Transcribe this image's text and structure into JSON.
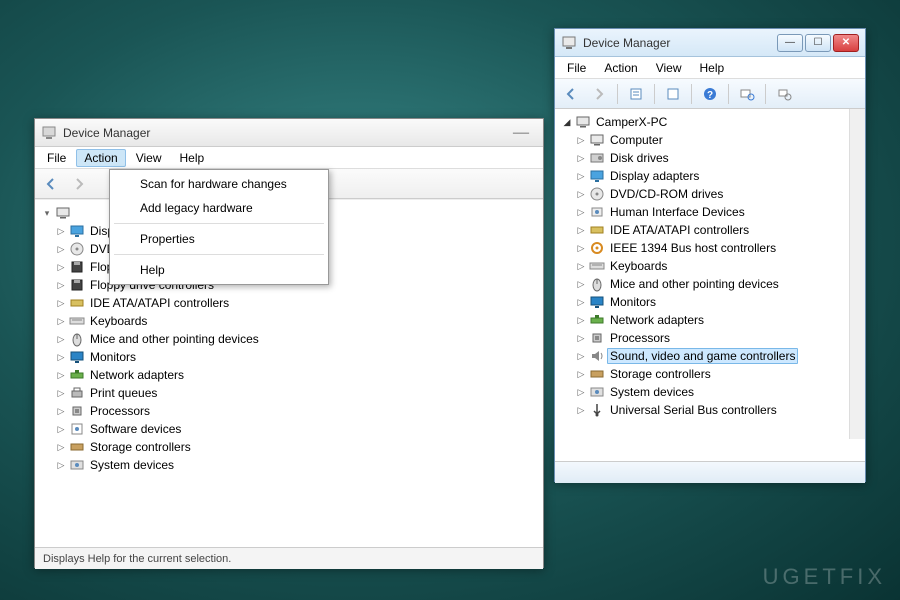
{
  "watermark": "UGETFIX",
  "left_window": {
    "title": "Device Manager",
    "menus": [
      "File",
      "Action",
      "View",
      "Help"
    ],
    "active_menu_index": 1,
    "dropdown": {
      "items": [
        "Scan for hardware changes",
        "Add legacy hardware",
        "Properties",
        "Help"
      ],
      "separators_after": [
        1,
        2
      ]
    },
    "toolbar_icons": [
      "back-icon",
      "forward-icon"
    ],
    "tree": {
      "root_expander": "▾",
      "root_icon": "computer-root-icon",
      "children": [
        {
          "label": "Display adapters",
          "icon": "display-icon"
        },
        {
          "label": "DVD/CD-ROM drives",
          "icon": "optical-icon"
        },
        {
          "label": "Floppy disk drives",
          "icon": "floppy-icon"
        },
        {
          "label": "Floppy drive controllers",
          "icon": "floppy-icon"
        },
        {
          "label": "IDE ATA/ATAPI controllers",
          "icon": "controller-icon"
        },
        {
          "label": "Keyboards",
          "icon": "keyboard-icon"
        },
        {
          "label": "Mice and other pointing devices",
          "icon": "mouse-icon"
        },
        {
          "label": "Monitors",
          "icon": "monitor-icon"
        },
        {
          "label": "Network adapters",
          "icon": "network-icon"
        },
        {
          "label": "Print queues",
          "icon": "printer-icon"
        },
        {
          "label": "Processors",
          "icon": "cpu-icon"
        },
        {
          "label": "Software devices",
          "icon": "software-icon"
        },
        {
          "label": "Storage controllers",
          "icon": "storage-icon"
        },
        {
          "label": "System devices",
          "icon": "system-icon"
        }
      ]
    },
    "status": "Displays Help for the current selection."
  },
  "right_window": {
    "title": "Device Manager",
    "menus": [
      "File",
      "Action",
      "View",
      "Help"
    ],
    "toolbar_icons": [
      "back-icon",
      "forward-icon",
      "sep",
      "properties-icon",
      "sep",
      "refresh-icon",
      "sep",
      "help-icon",
      "sep",
      "scan-icon",
      "sep",
      "uninstall-icon"
    ],
    "tree": {
      "root_label": "CamperX-PC",
      "root_icon": "computer-root-icon",
      "root_expander": "▸",
      "children": [
        {
          "label": "Computer",
          "icon": "computer-icon"
        },
        {
          "label": "Disk drives",
          "icon": "disk-icon"
        },
        {
          "label": "Display adapters",
          "icon": "display-icon"
        },
        {
          "label": "DVD/CD-ROM drives",
          "icon": "optical-icon"
        },
        {
          "label": "Human Interface Devices",
          "icon": "hid-icon"
        },
        {
          "label": "IDE ATA/ATAPI controllers",
          "icon": "controller-icon"
        },
        {
          "label": "IEEE 1394 Bus host controllers",
          "icon": "firewire-icon"
        },
        {
          "label": "Keyboards",
          "icon": "keyboard-icon"
        },
        {
          "label": "Mice and other pointing devices",
          "icon": "mouse-icon"
        },
        {
          "label": "Monitors",
          "icon": "monitor-icon"
        },
        {
          "label": "Network adapters",
          "icon": "network-icon"
        },
        {
          "label": "Processors",
          "icon": "cpu-icon"
        },
        {
          "label": "Sound, video and game controllers",
          "icon": "sound-icon",
          "selected": true
        },
        {
          "label": "Storage controllers",
          "icon": "storage-icon"
        },
        {
          "label": "System devices",
          "icon": "system-icon"
        },
        {
          "label": "Universal Serial Bus controllers",
          "icon": "usb-icon"
        }
      ]
    }
  }
}
